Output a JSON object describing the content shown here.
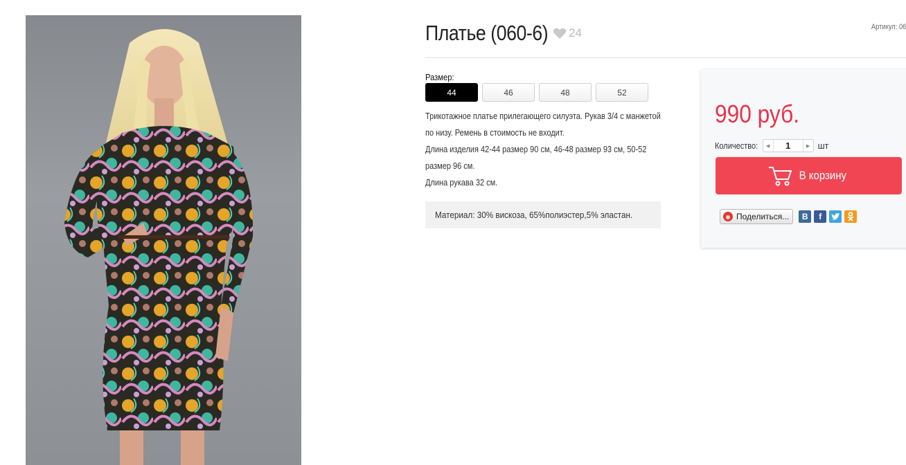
{
  "product": {
    "title": "Платье (060-6)",
    "likes": "24",
    "article": "Артикул: 06",
    "image_alt": "photo",
    "size_label": "Размер:",
    "sizes": [
      "44",
      "46",
      "48",
      "52"
    ],
    "selected_size": "44",
    "description": [
      "Трикотажное платье прилегающего силуэта. Рукав 3/4 с манжетой",
      "по низу. Ремень в стоимость не входит.",
      "Длина изделия 42-44 размер 90 см, 46-48 размер 93 см, 50-52",
      "размер  96 см.",
      "Длина рукава  32 см."
    ],
    "material": "Материал: 30% вискоза, 65%полиэстер,5% эластан."
  },
  "buy": {
    "price": "990 руб.",
    "qty_label": "Количество:",
    "qty_value": "1",
    "qty_unit": "шт",
    "cart_label": "В корзину",
    "accent": "#f14553",
    "price_color": "#e8334a"
  },
  "share": {
    "label": "Поделиться...",
    "networks": [
      {
        "icon": "vk-icon",
        "glyph": "В"
      },
      {
        "icon": "facebook-icon",
        "glyph": "f"
      },
      {
        "icon": "twitter-icon",
        "glyph": "t"
      },
      {
        "icon": "odnoklassniki-icon",
        "glyph": "ok"
      }
    ]
  }
}
